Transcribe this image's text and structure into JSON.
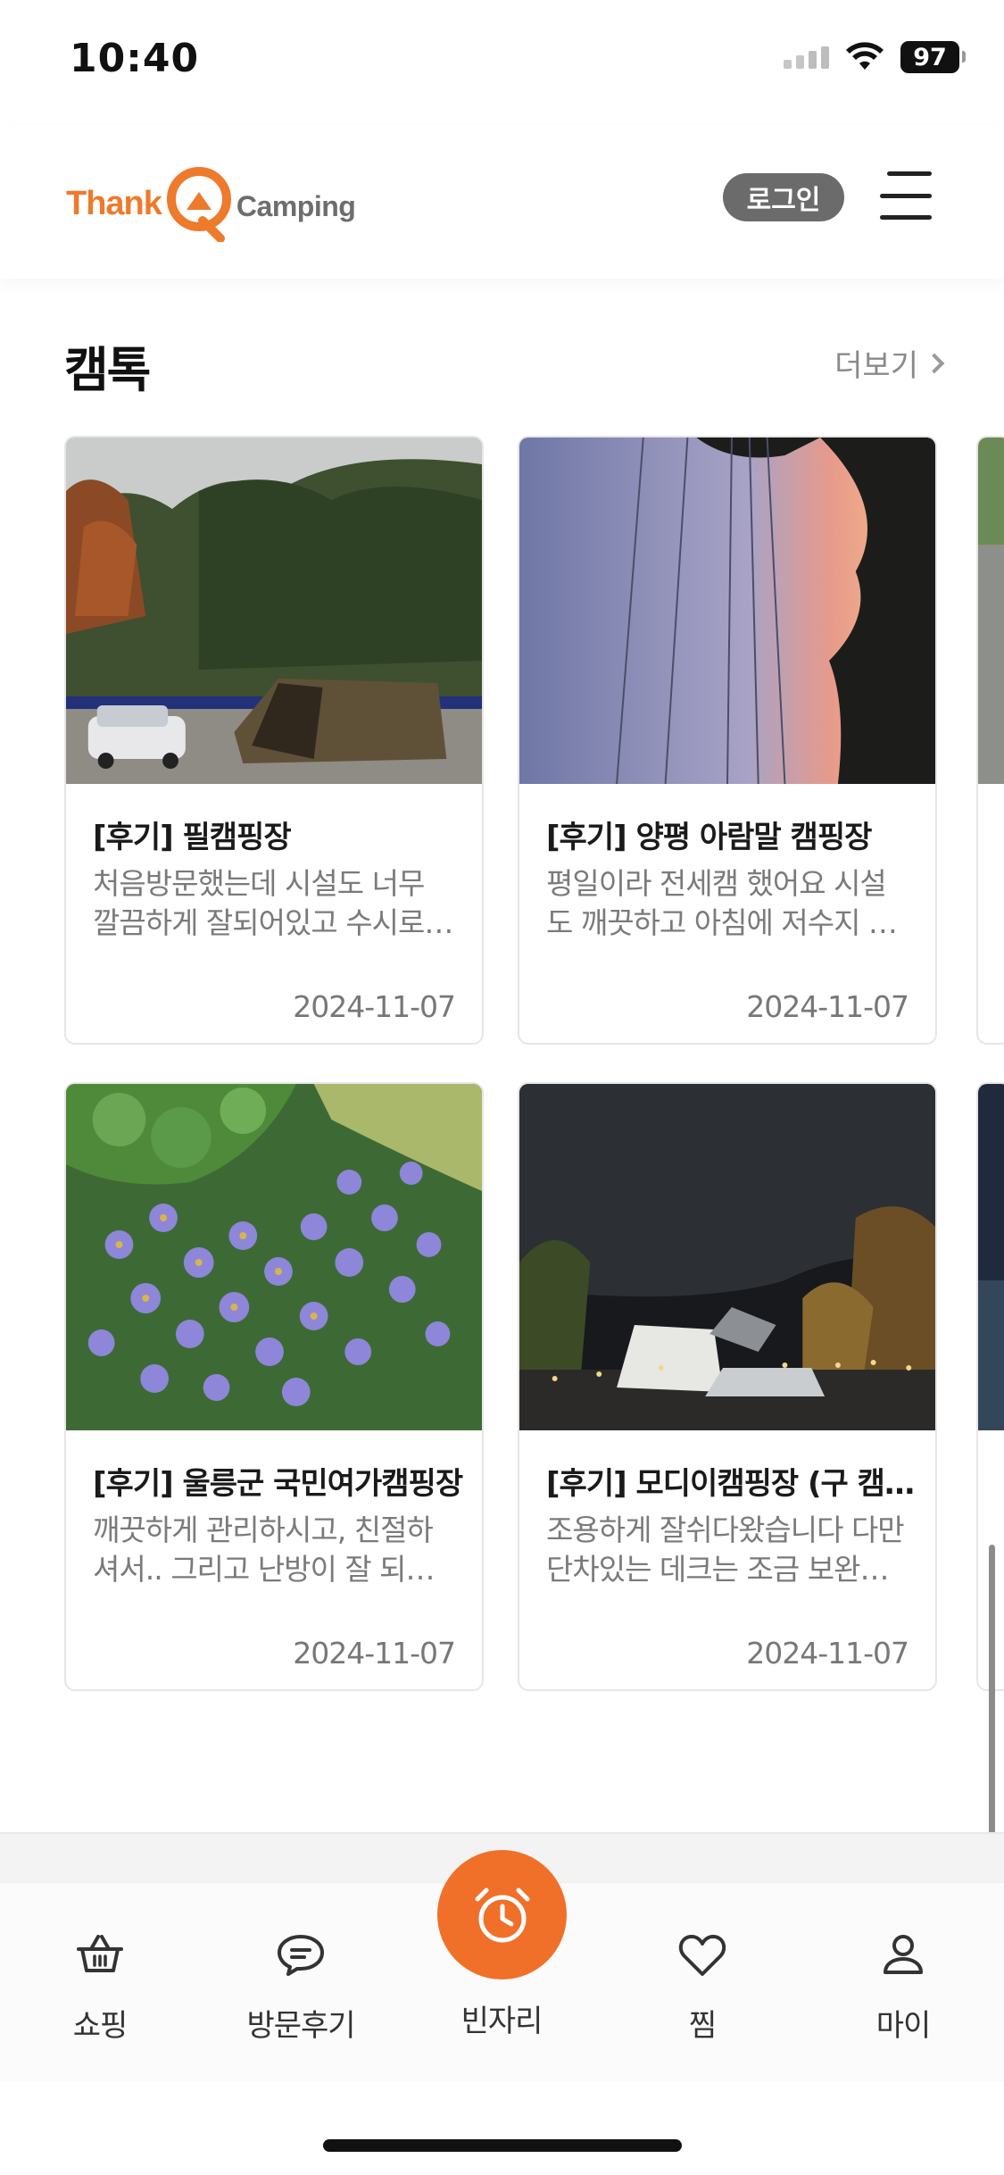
{
  "status_bar": {
    "time": "10:40",
    "battery": "97"
  },
  "header": {
    "logo": {
      "part1": "Thank",
      "part2": "Q",
      "part3": "Camping"
    },
    "login_label": "로그인"
  },
  "section": {
    "title": "캠톡",
    "more_label": "더보기"
  },
  "cards": [
    {
      "title": "[후기] 필캠핑장",
      "desc": "처음방문했는데 시설도 너무 깔끔하게 잘되어있고 수시로 관리해주시고",
      "date": "2024-11-07"
    },
    {
      "title": "[후기] 양평 아람말 캠핑장",
      "desc": "평일이라 전세캠 했어요 시설도 깨끗하고 아침에 저수지 풍경이 좋아요",
      "date": "2024-11-07"
    },
    {
      "title": "[후기] 울릉군 국민여가캠핑장",
      "desc": "깨끗하게 관리하시고, 친절하셔서.. 그리고 난방이 잘 되어 있어요",
      "date": "2024-11-07"
    },
    {
      "title": "[후기] 모디이캠핑장 (구 캠핑장)",
      "desc": "조용하게 잘쉬다왔습니다 다만 단차있는 데크는 조금 보완이 필요해요",
      "date": "2024-11-07"
    }
  ],
  "bottom_nav": {
    "items": [
      {
        "label": "쇼핑",
        "icon": "basket-icon"
      },
      {
        "label": "방문후기",
        "icon": "chat-bubble-icon"
      },
      {
        "label": "빈자리",
        "icon": "alarm-clock-icon"
      },
      {
        "label": "찜",
        "icon": "heart-icon"
      },
      {
        "label": "마이",
        "icon": "person-icon"
      }
    ]
  },
  "colors": {
    "accent": "#f0702a",
    "logo_orange": "#ee7a2c",
    "login_bg": "#6b6b6b"
  }
}
